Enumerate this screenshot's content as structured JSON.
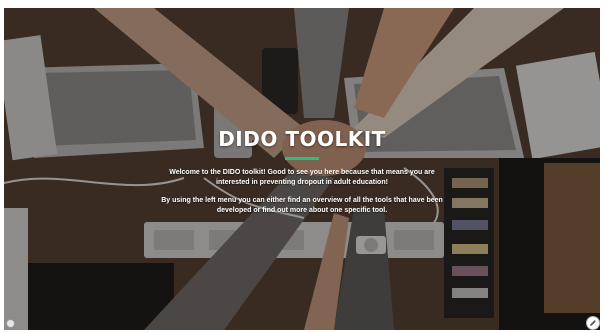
{
  "hero": {
    "title": "DIDO TOOLKIT",
    "paragraph1": "Welcome to the DIDO toolkit! Good to see you here because that means you are interested in preventing dropout in adult education!",
    "paragraph2": "By using the left menu you can either find an overview of all the tools that have been developed or find out more about one specific tool."
  },
  "colors": {
    "accent": "#2bbf7b",
    "overlay": "#14100e"
  },
  "icons": {
    "corner_button": "pencil-icon",
    "corner_dot": "circle-icon"
  }
}
